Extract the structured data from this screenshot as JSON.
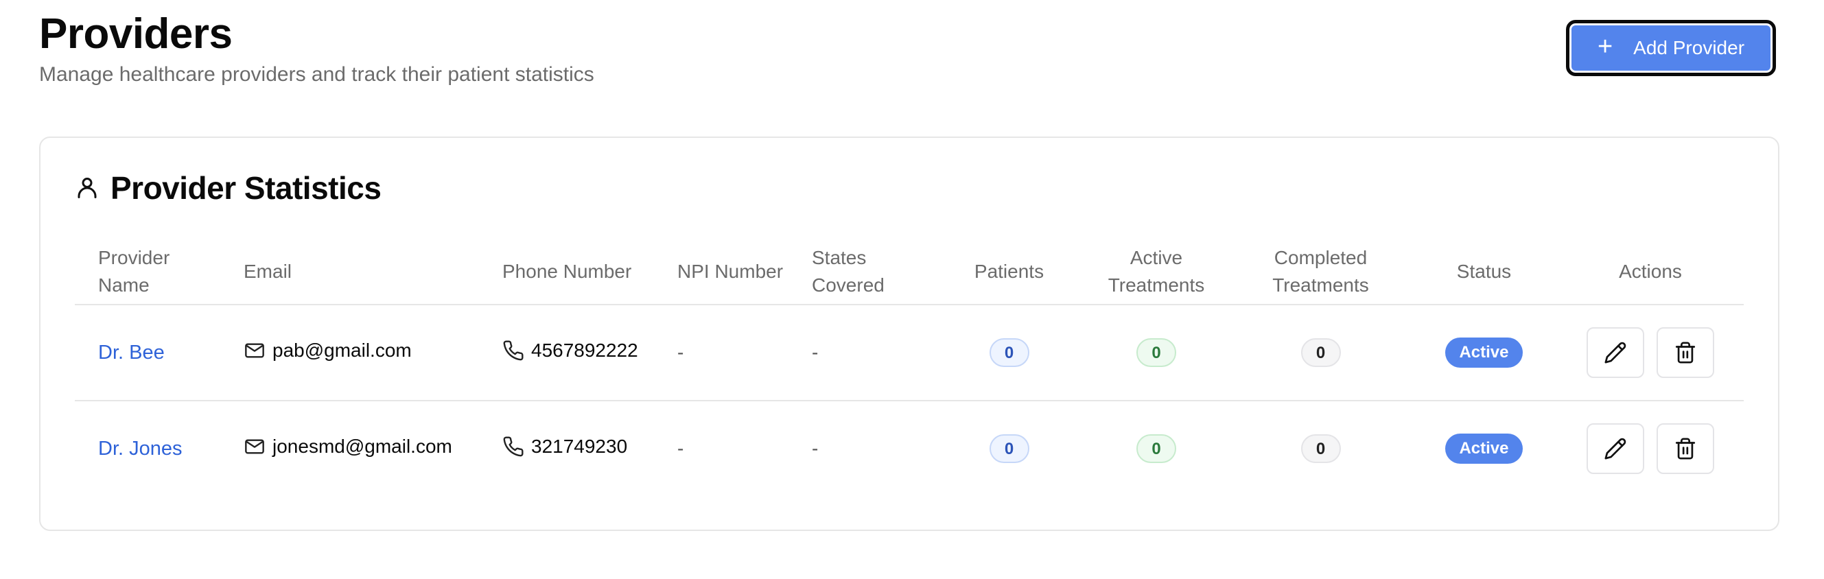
{
  "header": {
    "title": "Providers",
    "subtitle": "Manage healthcare providers and track their patient statistics",
    "add_button_label": "Add Provider",
    "add_button_icon": "plus-icon"
  },
  "card": {
    "title": "Provider Statistics",
    "icon": "user-icon"
  },
  "table": {
    "columns": {
      "provider_name": "Provider Name",
      "email": "Email",
      "phone": "Phone Number",
      "npi": "NPI Number",
      "states": "States Covered",
      "patients": "Patients",
      "active": "Active Treatments",
      "completed": "Completed Treatments",
      "status": "Status",
      "actions": "Actions"
    },
    "rows": [
      {
        "name": "Dr. Bee",
        "email": "pab@gmail.com",
        "phone": "4567892222",
        "npi": "-",
        "states": "-",
        "patients": "0",
        "active_treatments": "0",
        "completed_treatments": "0",
        "status": "Active"
      },
      {
        "name": "Dr. Jones",
        "email": "jonesmd@gmail.com",
        "phone": "321749230",
        "npi": "-",
        "states": "-",
        "patients": "0",
        "active_treatments": "0",
        "completed_treatments": "0",
        "status": "Active"
      }
    ]
  },
  "colors": {
    "accent": "#5384ec",
    "link": "#2e62d8",
    "border": "#e6e6e6",
    "muted_text": "#6b6b6b"
  }
}
